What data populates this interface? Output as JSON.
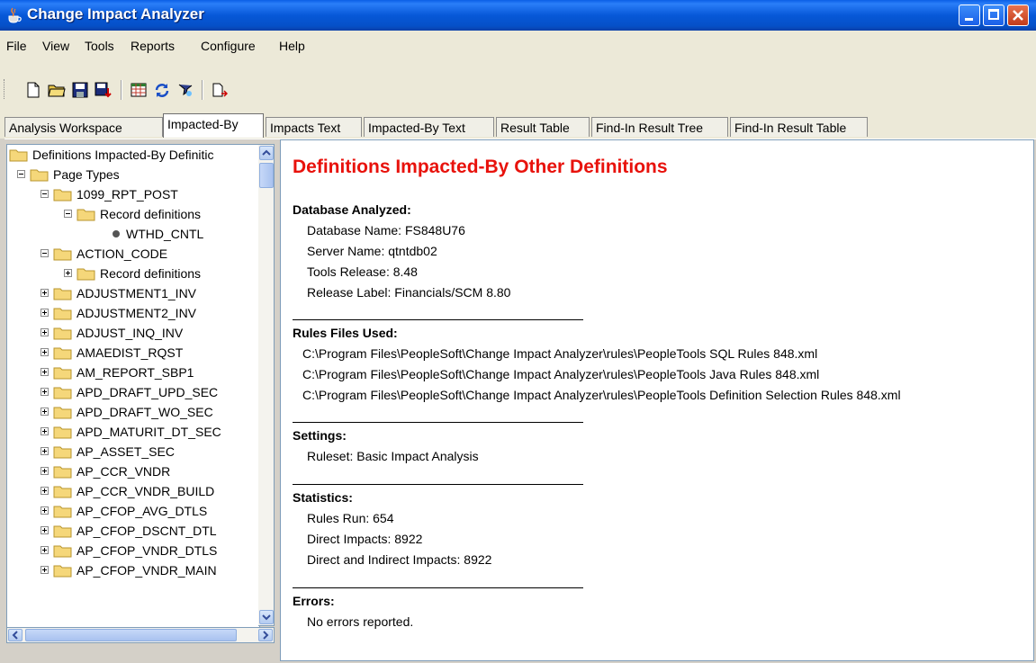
{
  "window": {
    "title": "Change Impact Analyzer"
  },
  "menu": [
    "File",
    "View",
    "Tools",
    "Reports",
    "Configure",
    "Help"
  ],
  "toolbar": {
    "icons": [
      "new-icon",
      "open-folder-icon",
      "save-icon",
      "save-as-icon",
      "grid-icon",
      "refresh-icon",
      "filter-icon",
      "export-icon"
    ]
  },
  "tabs": [
    {
      "label": "Analysis Workspace",
      "active": false
    },
    {
      "label": "Impacted-By",
      "active": true
    },
    {
      "label": "Impacts Text",
      "active": false
    },
    {
      "label": "Impacted-By Text",
      "active": false
    },
    {
      "label": "Result Table",
      "active": false
    },
    {
      "label": "Find-In Result Tree",
      "active": false
    },
    {
      "label": "Find-In Result Table",
      "active": false
    }
  ],
  "tree": {
    "root": "Definitions Impacted-By Definitic",
    "nodes": [
      {
        "label": "Page Types",
        "state": "expanded"
      },
      {
        "label": "1099_RPT_POST",
        "state": "expanded"
      },
      {
        "label": "Record definitions",
        "state": "expanded"
      },
      {
        "label": "WTHD_CNTL",
        "state": "leaf"
      },
      {
        "label": "ACTION_CODE",
        "state": "expanded"
      },
      {
        "label": "Record definitions",
        "state": "collapsed"
      },
      {
        "label": "ADJUSTMENT1_INV",
        "state": "collapsed"
      },
      {
        "label": "ADJUSTMENT2_INV",
        "state": "collapsed"
      },
      {
        "label": "ADJUST_INQ_INV",
        "state": "collapsed"
      },
      {
        "label": "AMAEDIST_RQST",
        "state": "collapsed"
      },
      {
        "label": "AM_REPORT_SBP1",
        "state": "collapsed"
      },
      {
        "label": "APD_DRAFT_UPD_SEC",
        "state": "collapsed"
      },
      {
        "label": "APD_DRAFT_WO_SEC",
        "state": "collapsed"
      },
      {
        "label": "APD_MATURIT_DT_SEC",
        "state": "collapsed"
      },
      {
        "label": "AP_ASSET_SEC",
        "state": "collapsed"
      },
      {
        "label": "AP_CCR_VNDR",
        "state": "collapsed"
      },
      {
        "label": "AP_CCR_VNDR_BUILD",
        "state": "collapsed"
      },
      {
        "label": "AP_CFOP_AVG_DTLS",
        "state": "collapsed"
      },
      {
        "label": "AP_CFOP_DSCNT_DTL",
        "state": "collapsed"
      },
      {
        "label": "AP_CFOP_VNDR_DTLS",
        "state": "collapsed"
      },
      {
        "label": "AP_CFOP_VNDR_MAIN",
        "state": "collapsed"
      }
    ]
  },
  "report": {
    "title": "Definitions Impacted-By Other Definitions",
    "database": {
      "heading": "Database Analyzed:",
      "lines": [
        "Database Name: FS848U76",
        "Server Name: qtntdb02",
        "Tools Release: 8.48",
        "Release Label: Financials/SCM 8.80"
      ]
    },
    "rules": {
      "heading": "Rules Files Used:",
      "lines": [
        "C:\\Program Files\\PeopleSoft\\Change Impact Analyzer\\rules\\PeopleTools SQL Rules 848.xml",
        "C:\\Program Files\\PeopleSoft\\Change Impact Analyzer\\rules\\PeopleTools Java Rules 848.xml",
        "C:\\Program Files\\PeopleSoft\\Change Impact Analyzer\\rules\\PeopleTools Definition Selection Rules 848.xml"
      ]
    },
    "settings": {
      "heading": "Settings:",
      "lines": [
        "Ruleset: Basic Impact Analysis"
      ]
    },
    "statistics": {
      "heading": "Statistics:",
      "lines": [
        "Rules Run: 654",
        "Direct Impacts: 8922",
        "Direct and Indirect Impacts: 8922"
      ]
    },
    "errors": {
      "heading": "Errors:",
      "lines": [
        "No errors reported."
      ]
    }
  },
  "colors": {
    "title_red": "#e8120c",
    "titlebar_blue": "#0758d8",
    "folder_yellow": "#f5d77a"
  }
}
